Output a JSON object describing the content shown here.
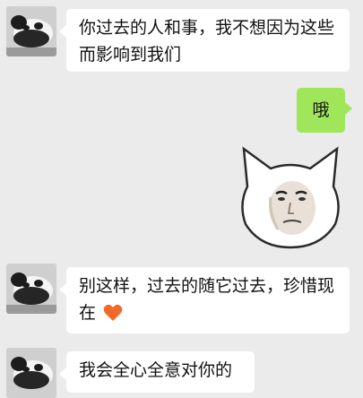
{
  "messages": [
    {
      "side": "left",
      "text": "你过去的人和事，我不想因为这些而影响到我们",
      "avatar": "panda-avatar"
    },
    {
      "side": "right",
      "text": "哦"
    },
    {
      "side": "right",
      "type": "sticker",
      "icon": "cat-face-sticker-icon"
    },
    {
      "side": "left",
      "text": "别这样，过去的随它过去，珍惜现在",
      "emoji": "heart-icon",
      "avatar": "panda-avatar"
    },
    {
      "side": "left",
      "text": "我会全心全意对你的",
      "avatar": "panda-avatar"
    }
  ],
  "colors": {
    "background": "#ebebeb",
    "incoming_bubble": "#ffffff",
    "outgoing_bubble": "#9fe65a",
    "heart": "#f2682a"
  }
}
